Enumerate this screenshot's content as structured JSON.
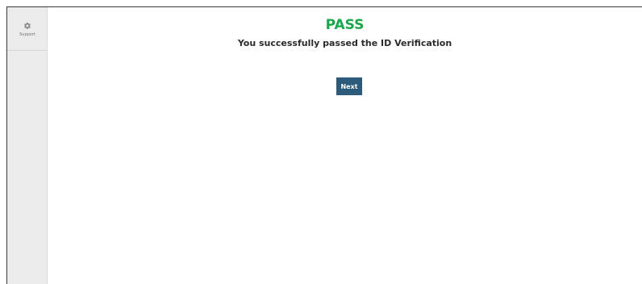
{
  "sidebar": {
    "support": {
      "icon": "gear-icon",
      "label": "Support"
    }
  },
  "main": {
    "status": "PASS",
    "status_color": "#17a84a",
    "message": "You successfully passed the ID Verification",
    "next_label": "Next",
    "next_color": "#2b5a7a"
  }
}
